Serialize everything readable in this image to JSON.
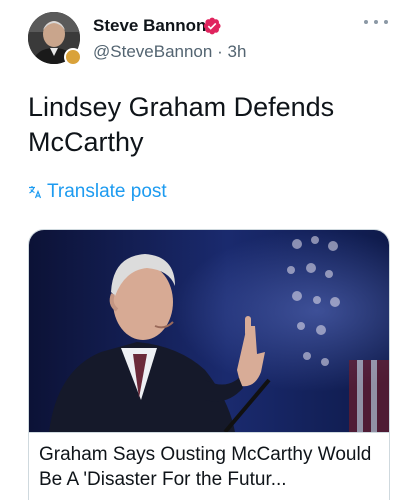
{
  "post": {
    "author": {
      "display_name": "Steve Bannon",
      "handle": "@SteveBannon",
      "separator": "·",
      "time_ago": "3h",
      "verified": true,
      "avatar_icon": "person-portrait-icon",
      "badge_icon": "affiliate-badge-icon"
    },
    "more_icon": "ellipsis-icon",
    "text": "Lindsey Graham Defends McCarthy",
    "translate": {
      "icon": "translate-icon",
      "label": "Translate post"
    },
    "link_card": {
      "image_icon": "news-photo-speaker-icon",
      "title": "Graham Says Ousting McCarthy Would Be A 'Disaster For the Futur..."
    }
  },
  "colors": {
    "link_blue": "#1d9bf0",
    "verified_red": "#e0245e",
    "secondary_text": "#536471",
    "border": "#cfd9de"
  }
}
